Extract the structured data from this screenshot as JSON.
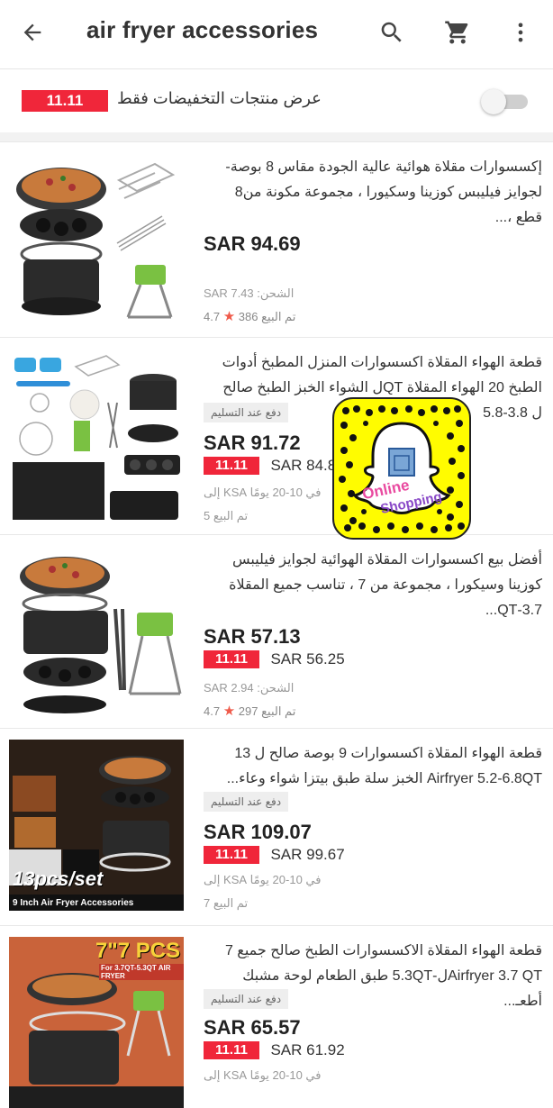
{
  "app": {
    "title": "air fryer accessories"
  },
  "filter": {
    "badge": "11.11",
    "label": "عرض منتجات التخفيضات فقط",
    "toggle_on": false
  },
  "colors": {
    "accent_red": "#f0263a",
    "star": "#ef5a4a",
    "snapchat_yellow": "#fffc00"
  },
  "items": [
    {
      "title": "إكسسوارات مقلاة هوائية عالية الجودة مقاس 8 بوصة-لجوايز فيليبس كوزينا وسكيورا ، مجموعة مكونة من8 قطع ،...",
      "price": "SAR 94.69",
      "shipping": "الشحن: SAR 7.43",
      "rating": "4.7",
      "sold": "تم البيع 386"
    },
    {
      "title": "قطعة الهواء المقلاة اكسسوارات المنزل المطبخ أدوات الطبخ 20 الهواء المقلاة QTل الشواء الخبز الطبخ صالح ل 3.8-5.8",
      "cod": "دفع عند التسليم",
      "price": "SAR 91.72",
      "promo_badge": "11.11",
      "promo_price": "SAR 84.8",
      "delivery": "في 10-20 يومًا KSA إلى",
      "sold": "تم البيع 5"
    },
    {
      "title": "أفضل بيع اكسسوارات المقلاة الهوائية لجوايز فيليبس كوزينا وسيكورا ، مجموعة من 7 ، تناسب جميع المقلاة 3.7-QT...",
      "price": "SAR 57.13",
      "promo_badge": "11.11",
      "promo_price": "SAR 56.25",
      "shipping": "الشحن: SAR 2.94",
      "rating": "4.7",
      "sold": "تم البيع 297"
    },
    {
      "title": "قطعة الهواء المقلاة اكسسوارات 9 بوصة صالح ل 13 Airfryer 5.2-6.8QT الخبز سلة طبق بيتزا شواء وعاء...",
      "cod": "دفع عند التسليم",
      "price": "SAR 109.07",
      "promo_badge": "11.11",
      "promo_price": "SAR 99.67",
      "delivery": "في 10-20 يومًا KSA إلى",
      "sold": "تم البيع 7",
      "image_text_1": "13pcs/set",
      "image_text_2": "9 Inch Air Fryer Accessories"
    },
    {
      "title": "قطعة الهواء المقلاة الاكسسوارات الطبخ صالح جميع 7 Airfryer 3.7 QTل-5.3QT طبق الطعام لوحة مشبك أطعـ...",
      "cod": "دفع عند التسليم",
      "price": "SAR 65.57",
      "promo_badge": "11.11",
      "promo_price": "SAR 61.92",
      "delivery": "في 10-20 يومًا KSA إلى",
      "image_text_1": "7\"7 PCS",
      "image_text_2": "For 3.7QT-5.3QT AIR FRYER"
    }
  ],
  "snapcode": {
    "text_1": "Online",
    "text_2": "Shopping"
  }
}
